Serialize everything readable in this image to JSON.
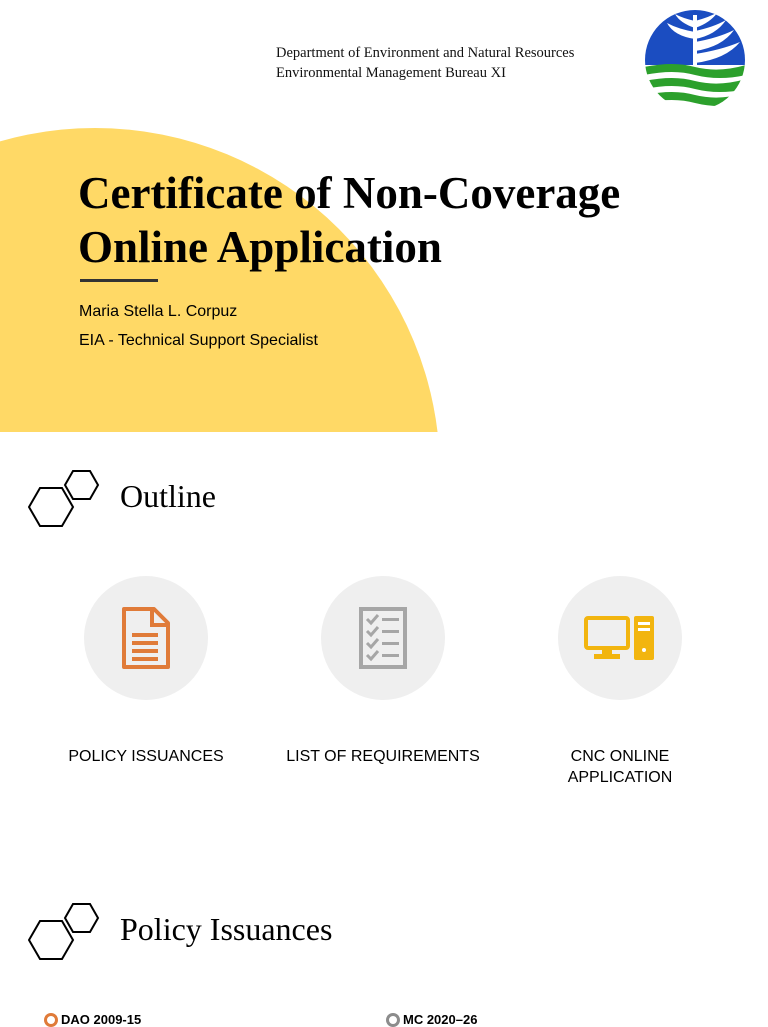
{
  "slide1": {
    "department_line1": "Department of Environment and Natural Resources",
    "department_line2": "Environmental Management Bureau XI",
    "title_line1": "Certificate of Non-Coverage",
    "title_line2": "Online Application",
    "presenter_name": "Maria Stella L. Corpuz",
    "presenter_role": "EIA - Technical Support Specialist",
    "logo_icon": "denr-logo",
    "accent_color": "#FFD966"
  },
  "slide2": {
    "heading": "Outline",
    "items": [
      {
        "label": "POLICY ISSUANCES",
        "icon": "document-icon",
        "color": "#E07B39"
      },
      {
        "label": "LIST OF REQUIREMENTS",
        "icon": "checklist-icon",
        "color": "#A6A6A6"
      },
      {
        "label": "CNC ONLINE APPLICATION",
        "icon": "computer-icon",
        "color": "#F2B50F"
      }
    ]
  },
  "slide3": {
    "heading": "Policy Issuances",
    "items": [
      {
        "label": "DAO 2009-15",
        "color": "#E07B39"
      },
      {
        "label": "MC 2020–26",
        "color": "#8C8C8C"
      }
    ]
  }
}
